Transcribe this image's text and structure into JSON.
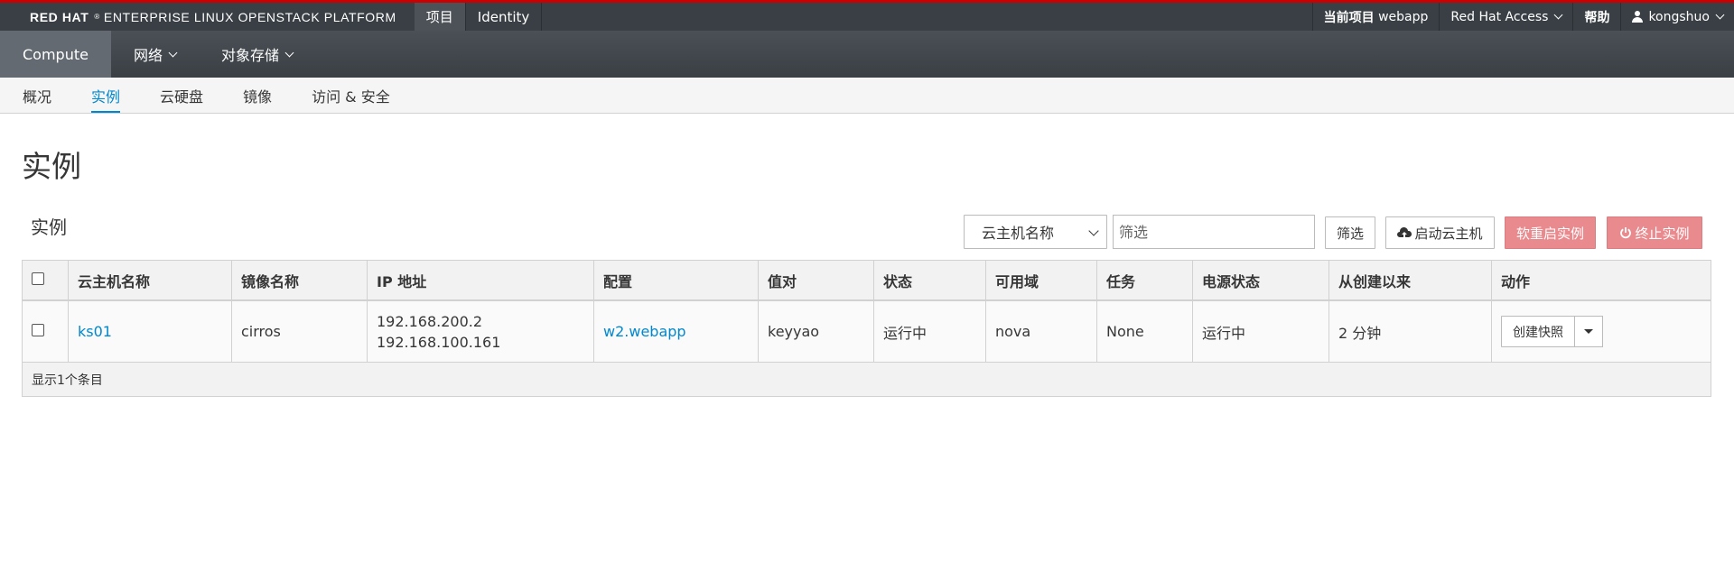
{
  "brand": {
    "bold": "RED HAT",
    "reg": "®",
    "rest": "ENTERPRISE LINUX OPENSTACK PLATFORM"
  },
  "topnav": {
    "project": "项目",
    "identity": "Identity"
  },
  "topright": {
    "current_project_label": "当前项目",
    "current_project": "webapp",
    "rh_access": "Red Hat Access",
    "help": "帮助",
    "user": "kongshuo"
  },
  "secnav": {
    "compute": "Compute",
    "network": "网络",
    "object_storage": "对象存储"
  },
  "tertnav": {
    "overview": "概况",
    "instances": "实例",
    "volumes": "云硬盘",
    "images": "镜像",
    "access_security": "访问 & 安全"
  },
  "page": {
    "title": "实例",
    "section": "实例"
  },
  "filter": {
    "select_value": "云主机名称",
    "placeholder": "筛选",
    "filter_button": "筛选",
    "launch_button": "启动云主机",
    "soft_reboot_button": "软重启实例",
    "terminate_button": "终止实例"
  },
  "table": {
    "headers": [
      "云主机名称",
      "镜像名称",
      "IP 地址",
      "配置",
      "值对",
      "状态",
      "可用域",
      "任务",
      "电源状态",
      "从创建以来",
      "动作"
    ],
    "rows": [
      {
        "name": "ks01",
        "image": "cirros",
        "ip1": "192.168.200.2",
        "ip2": "192.168.100.161",
        "flavor": "w2.webapp",
        "keypair": "keyyao",
        "status": "运行中",
        "az": "nova",
        "task": "None",
        "power": "运行中",
        "age": "2 分钟",
        "action": "创建快照"
      }
    ],
    "footer": "显示1个条目"
  },
  "colors": {
    "accent": "#0088ce",
    "danger": "#e88a8e",
    "brand_red": "#cc0000"
  }
}
